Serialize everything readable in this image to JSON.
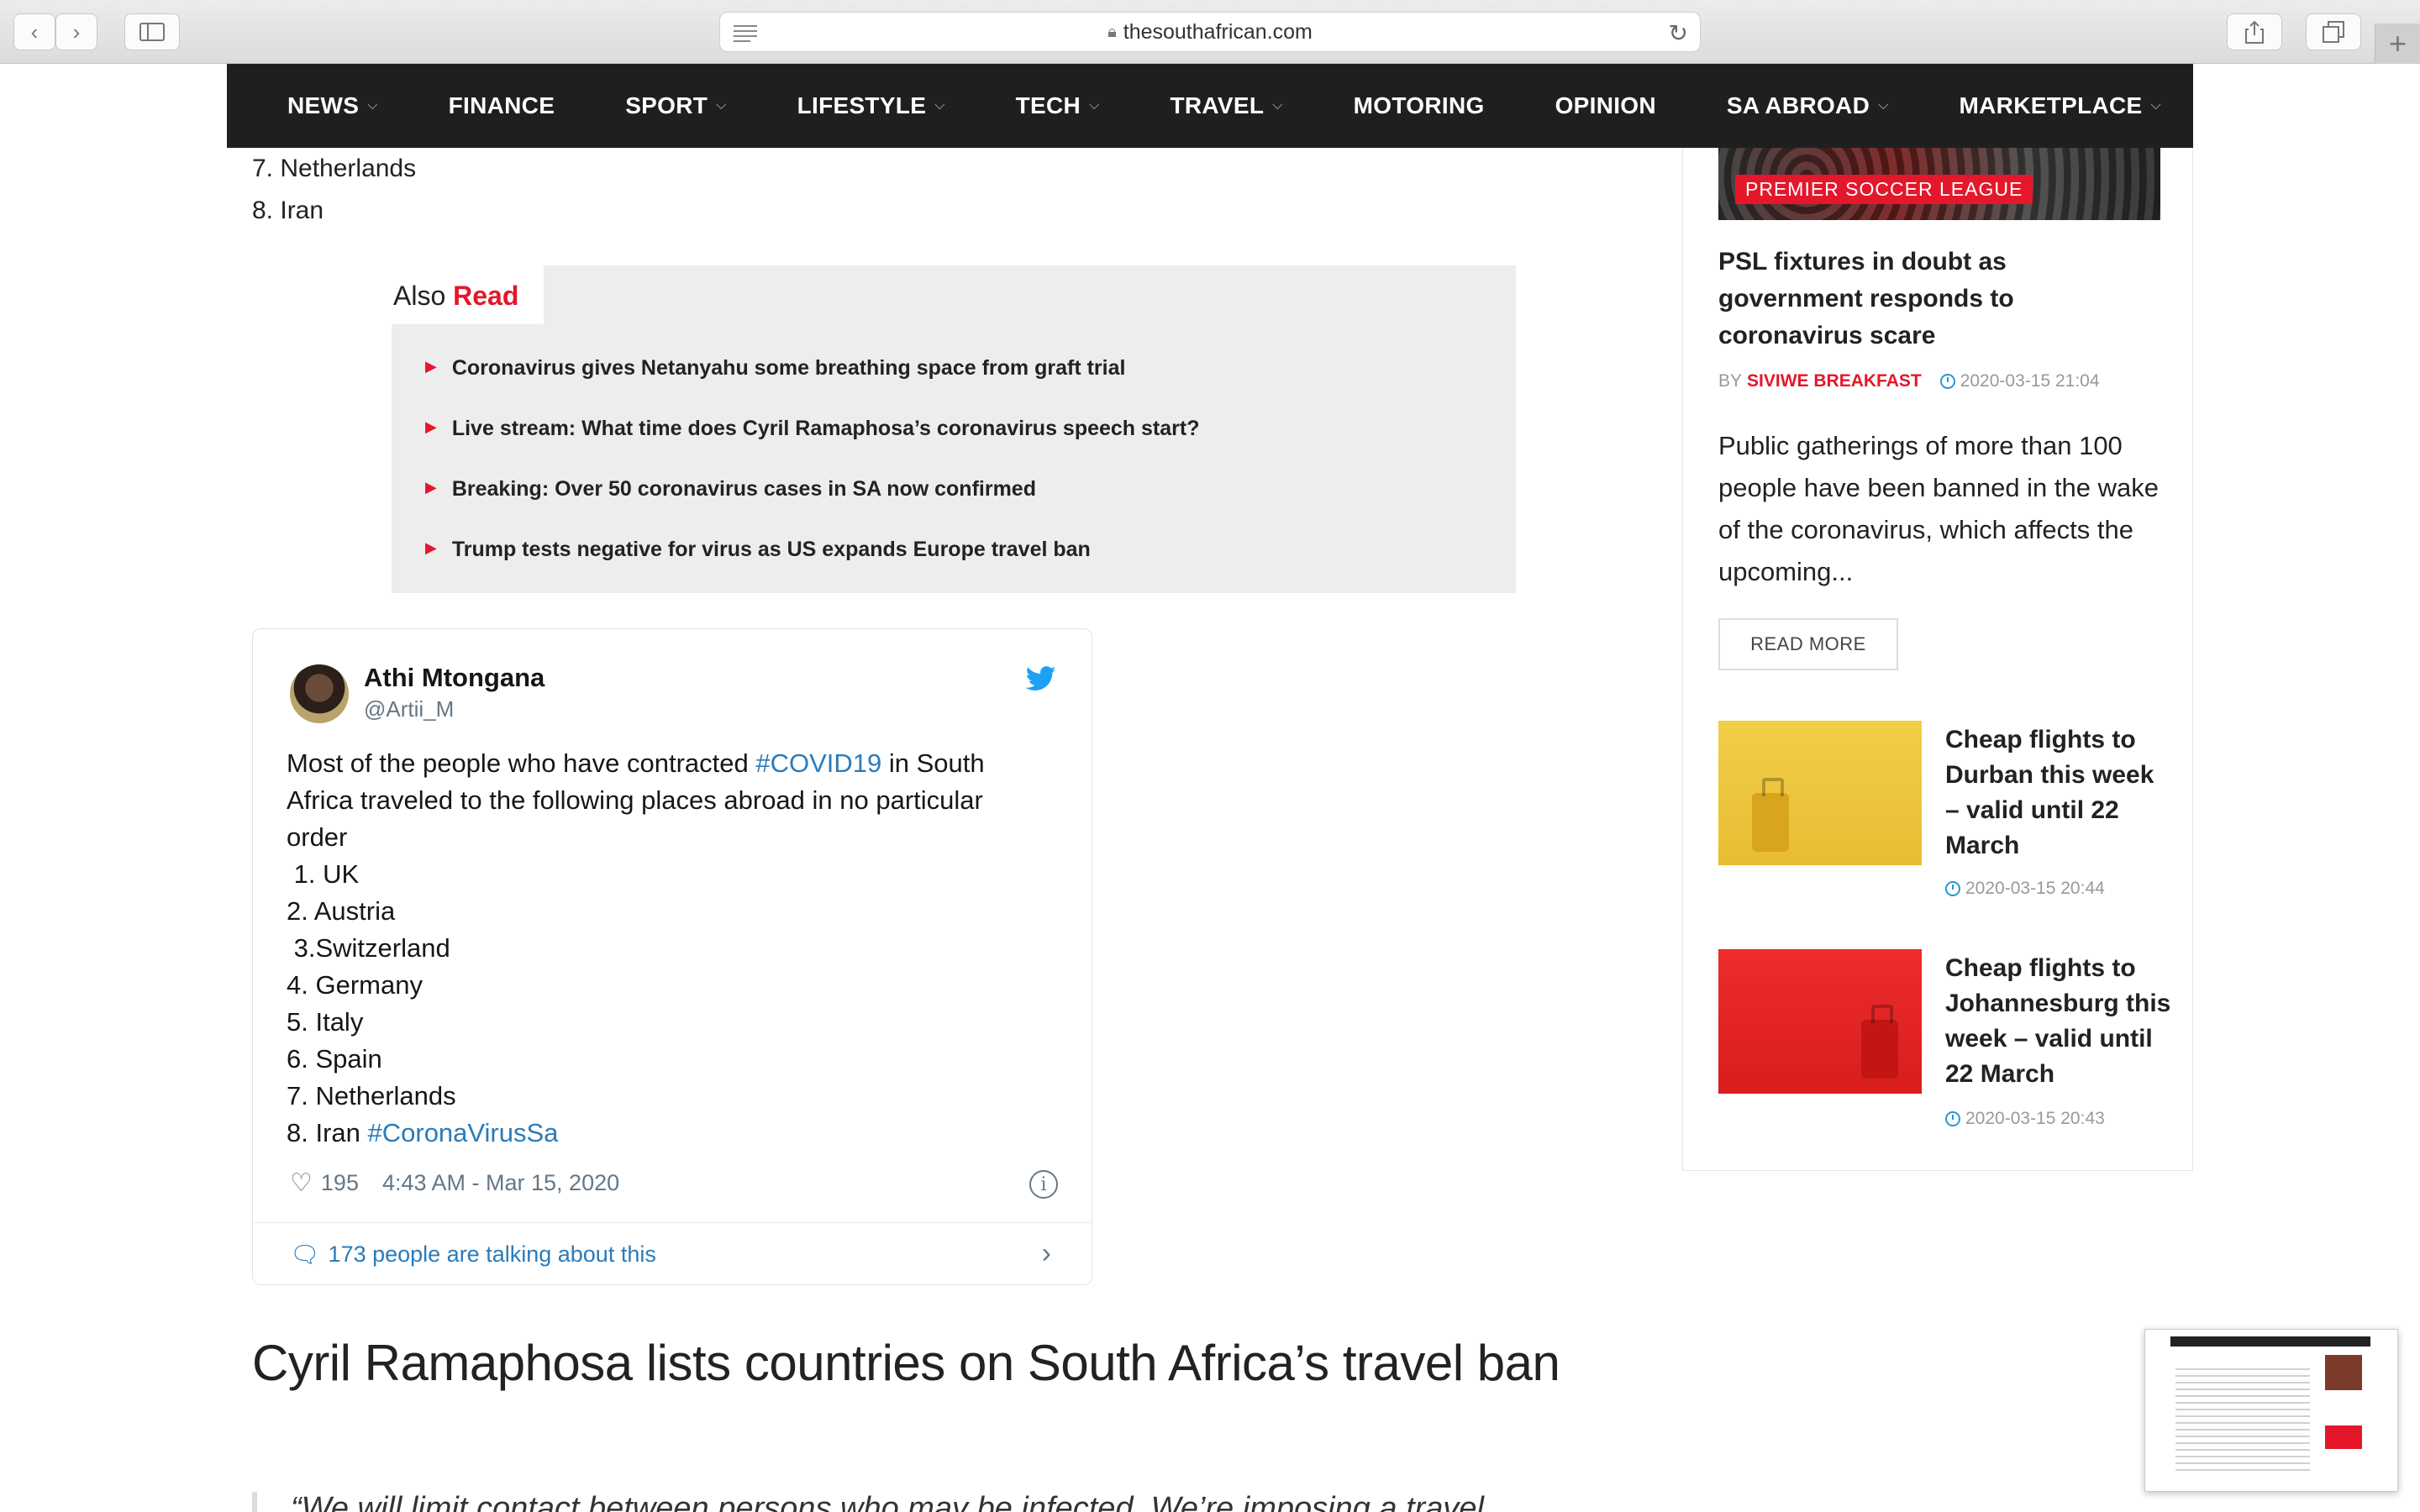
{
  "browser": {
    "url": "thesouthafrican.com"
  },
  "nav": {
    "items": [
      {
        "label": "NEWS",
        "dropdown": true
      },
      {
        "label": "FINANCE",
        "dropdown": false
      },
      {
        "label": "SPORT",
        "dropdown": true
      },
      {
        "label": "LIFESTYLE",
        "dropdown": true
      },
      {
        "label": "TECH",
        "dropdown": true
      },
      {
        "label": "TRAVEL",
        "dropdown": true
      },
      {
        "label": "MOTORING",
        "dropdown": false
      },
      {
        "label": "OPINION",
        "dropdown": false
      },
      {
        "label": "SA ABROAD",
        "dropdown": true
      },
      {
        "label": "MARKETPLACE",
        "dropdown": true
      }
    ]
  },
  "article": {
    "list_items": [
      "7. Netherlands",
      "8. Iran"
    ],
    "also_read": {
      "label_plain": "Also ",
      "label_accent": "Read",
      "links": [
        "Coronavirus gives Netanyahu some breathing space from graft trial",
        "Live stream: What time does Cyril Ramaphosa’s coronavirus speech start?",
        "Breaking: Over 50 coronavirus cases in SA now confirmed",
        "Trump tests negative for virus as US expands Europe travel ban"
      ]
    },
    "tweet": {
      "name": "Athi Mtongana",
      "handle": "@Artii_M",
      "text_prefix": "Most of the people who have contracted ",
      "hashtag_covid": "#COVID19",
      "text_suffix": " in South",
      "line2": "Africa traveled to the following places abroad in no particular",
      "line3": "order",
      "countries": [
        " 1. UK",
        "2. Austria",
        " 3.Switzerland",
        "4. Germany",
        "5. Italy",
        "6. Spain",
        "7. Netherlands"
      ],
      "last_country": "8. Iran ",
      "hashtag_sa": "#CoronaVirusSa",
      "likes": "195",
      "timestamp": "4:43 AM - Mar 15, 2020",
      "talking": "173 people are talking about this"
    },
    "section_heading": "Cyril Ramaphosa lists countries on South Africa’s travel ban",
    "quote_start": "“We will limit contact between persons who may be infected. We’re imposing a travel"
  },
  "sidebar": {
    "featured": {
      "category": "PREMIER SOCCER LEAGUE",
      "title": "PSL fixtures in doubt as government responds to coronavirus scare",
      "by": "BY",
      "author": "SIVIWE BREAKFAST",
      "date": "2020-03-15 21:04",
      "excerpt": "Public gatherings of more than 100 people have been banned in the wake of the coronavirus, which affects the upcoming...",
      "read_more": "READ MORE"
    },
    "cards": [
      {
        "title": "Cheap flights to Durban this week – valid until 22 March",
        "date": "2020-03-15 20:44",
        "thumb_color": "#efc940"
      },
      {
        "title": "Cheap flights to Johannesburg this week – valid until 22 March",
        "date": "2020-03-15 20:43",
        "thumb_color": "#e52626"
      }
    ]
  },
  "colors": {
    "accent_red": "#e4172b",
    "nav_bg": "#1f1f1f",
    "twitter_blue": "#1da1f2",
    "link_blue": "#2b7bb9"
  }
}
